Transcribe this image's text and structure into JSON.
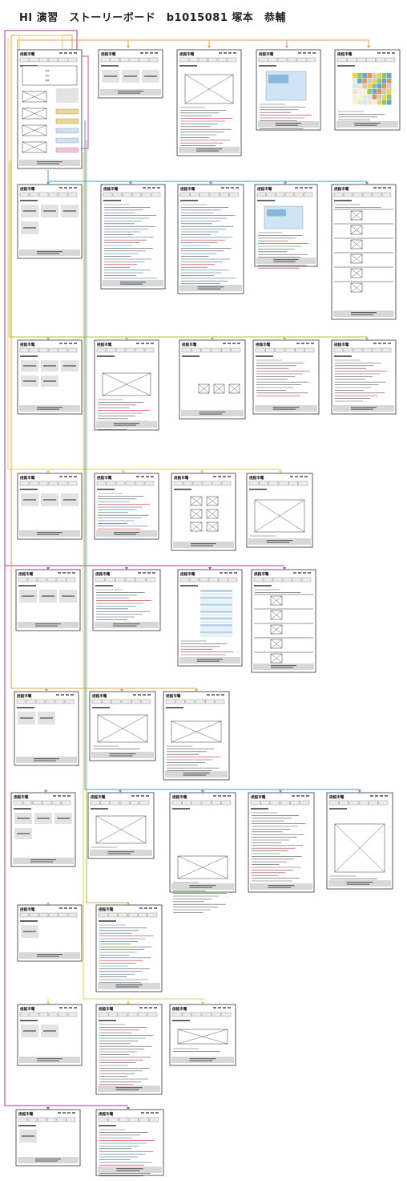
{
  "title": "HI 演習　ストーリーボード　b1015081 塚本　恭輔",
  "site_logo": "函館市電",
  "connector_colors": {
    "magenta": "#b0339e",
    "orange": "#e0a048",
    "yellow": "#e4cf4a",
    "green": "#a6c24a",
    "blue": "#4a9ad2",
    "pink": "#d94aa8"
  },
  "home_menu": [
    "路線",
    "時刻",
    "運賃"
  ]
}
